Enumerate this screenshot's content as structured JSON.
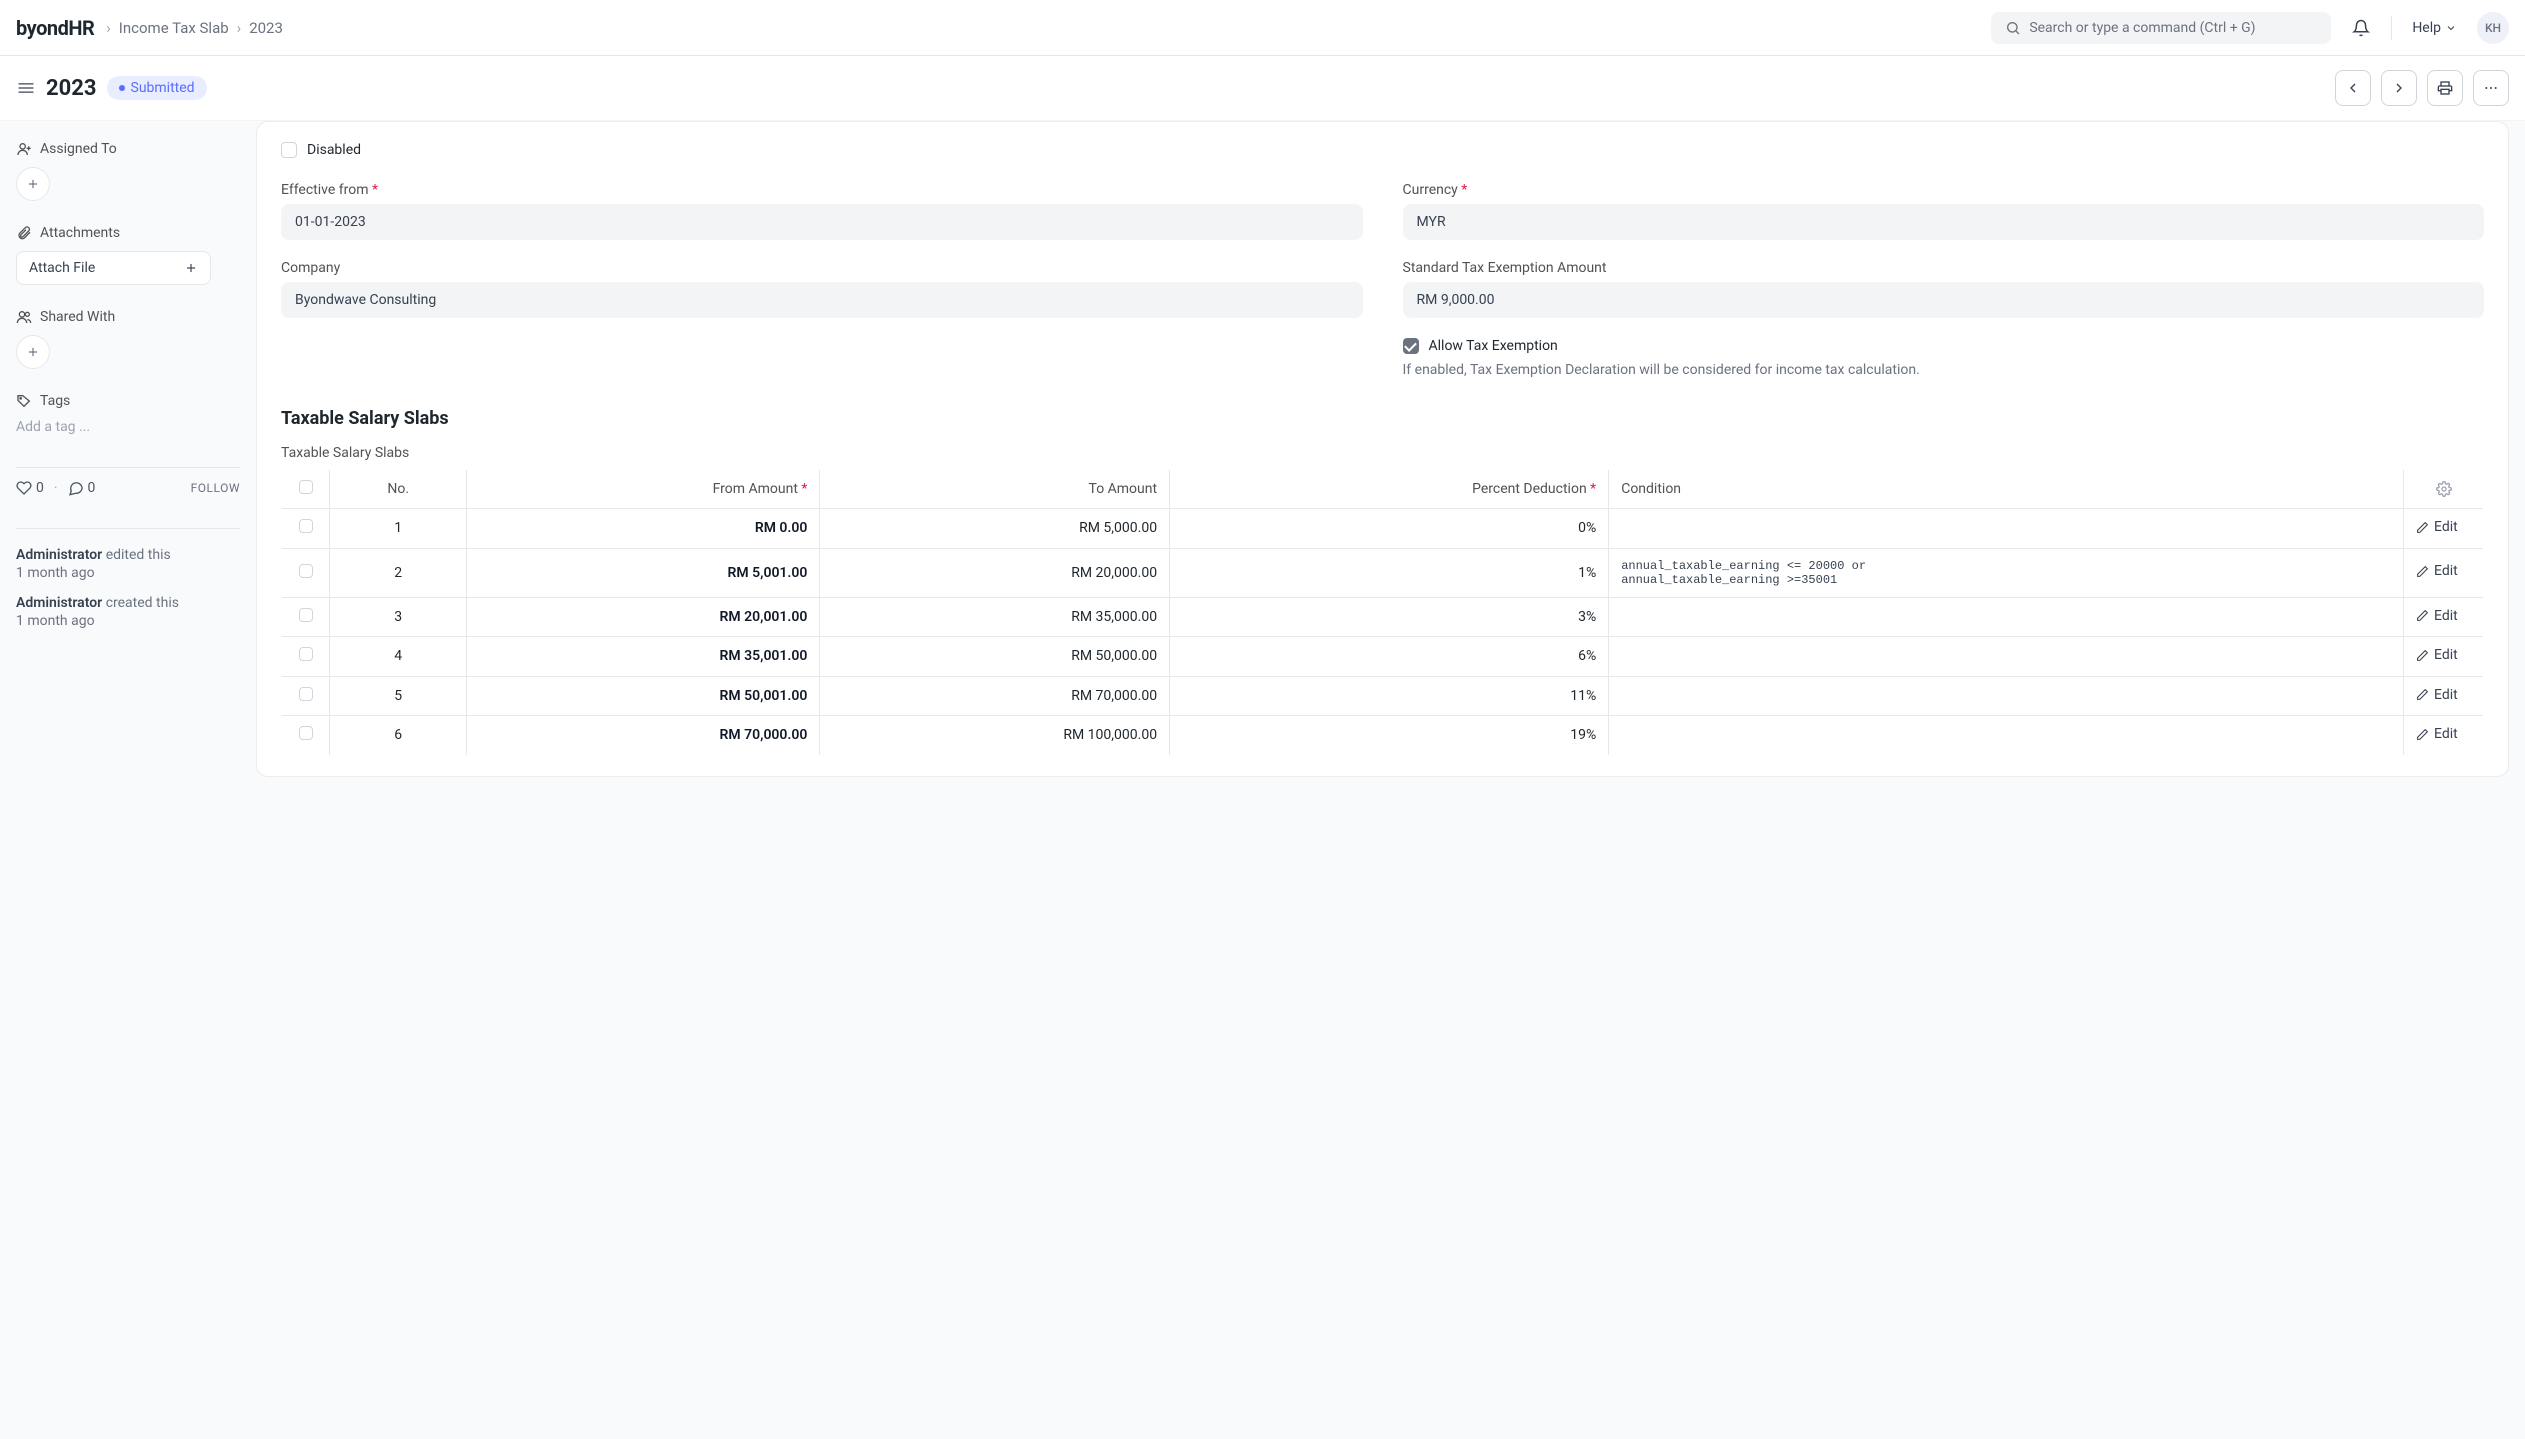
{
  "brand": "byondHR",
  "breadcrumb": {
    "parent": "Income Tax Slab",
    "current": "2023"
  },
  "search": {
    "placeholder": "Search or type a command (Ctrl + G)"
  },
  "help_label": "Help",
  "avatar_initials": "KH",
  "page": {
    "title": "2023",
    "status": "Submitted"
  },
  "sidebar": {
    "assigned_to": "Assigned To",
    "attachments": "Attachments",
    "attach_file": "Attach File",
    "shared_with": "Shared With",
    "tags": "Tags",
    "tag_placeholder": "Add a tag ...",
    "likes": "0",
    "comments": "0",
    "follow": "FOLLOW",
    "audit": [
      {
        "who": "Administrator",
        "action": "edited this",
        "when": "1 month ago"
      },
      {
        "who": "Administrator",
        "action": "created this",
        "when": "1 month ago"
      }
    ]
  },
  "form": {
    "disabled_label": "Disabled",
    "effective_from_label": "Effective from",
    "effective_from": "01-01-2023",
    "currency_label": "Currency",
    "currency": "MYR",
    "company_label": "Company",
    "company": "Byondwave Consulting",
    "std_exemption_label": "Standard Tax Exemption Amount",
    "std_exemption": "RM 9,000.00",
    "allow_exemption_label": "Allow Tax Exemption",
    "allow_exemption_help": "If enabled, Tax Exemption Declaration will be considered for income tax calculation."
  },
  "slabs": {
    "section_title": "Taxable Salary Slabs",
    "table_label": "Taxable Salary Slabs",
    "columns": {
      "no": "No.",
      "from": "From Amount",
      "to": "To Amount",
      "pct": "Percent Deduction",
      "cond": "Condition"
    },
    "edit_label": "Edit",
    "rows": [
      {
        "no": "1",
        "from": "RM 0.00",
        "to": "RM 5,000.00",
        "pct": "0%",
        "cond": "",
        "edit": "Edit"
      },
      {
        "no": "2",
        "from": "RM 5,001.00",
        "to": "RM 20,000.00",
        "pct": "1%",
        "cond": "annual_taxable_earning <= 20000 or\nannual_taxable_earning >=35001",
        "edit": "Edit"
      },
      {
        "no": "3",
        "from": "RM 20,001.00",
        "to": "RM 35,000.00",
        "pct": "3%",
        "cond": "",
        "edit": "Edit"
      },
      {
        "no": "4",
        "from": "RM 35,001.00",
        "to": "RM 50,000.00",
        "pct": "6%",
        "cond": "",
        "edit": "Edit"
      },
      {
        "no": "5",
        "from": "RM 50,001.00",
        "to": "RM 70,000.00",
        "pct": "11%",
        "cond": "",
        "edit": "Edit"
      },
      {
        "no": "6",
        "from": "RM 70,000.00",
        "to": "RM 100,000.00",
        "pct": "19%",
        "cond": "",
        "edit": "Edit"
      }
    ]
  }
}
